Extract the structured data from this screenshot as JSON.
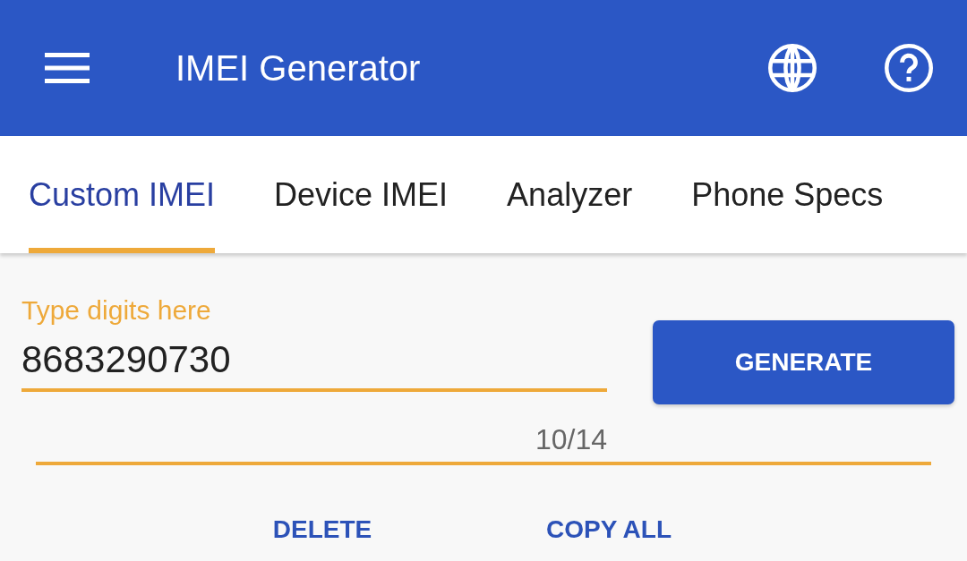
{
  "app_bar": {
    "title": "IMEI Generator"
  },
  "tabs": [
    {
      "label": "Custom IMEI",
      "selected": true
    },
    {
      "label": "Device IMEI",
      "selected": false
    },
    {
      "label": "Analyzer",
      "selected": false
    },
    {
      "label": "Phone Specs",
      "selected": false
    }
  ],
  "imei_field": {
    "label": "Type digits here",
    "value": "8683290730",
    "counter": "10/14",
    "focused": true
  },
  "generate_button": {
    "label": "GENERATE"
  },
  "actions": [
    {
      "label": "DELETE"
    },
    {
      "label": "COPY ALL"
    }
  ]
}
